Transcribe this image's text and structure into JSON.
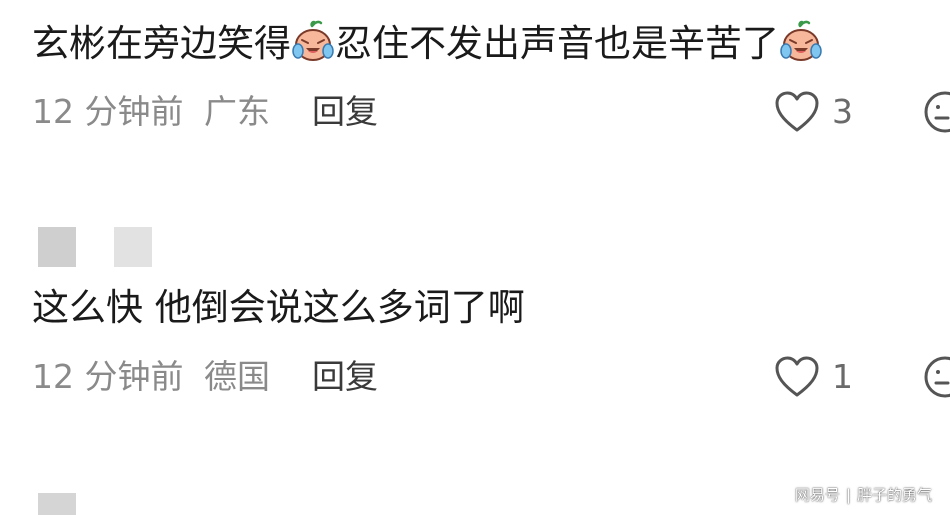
{
  "comments": [
    {
      "text_parts": [
        "玄彬在旁边笑得",
        "忍住不发出声音也是辛苦了",
        ""
      ],
      "emoji": "laugh-cry-icon",
      "time": "12 分钟前",
      "location": "广东",
      "reply_label": "回复",
      "likes": "3"
    },
    {
      "text": "这么快 他倒会说这么多词了啊",
      "time": "12 分钟前",
      "location": "德国",
      "reply_label": "回复",
      "likes": "1"
    }
  ],
  "watermark": {
    "brand": "网易号",
    "separator": "|",
    "author": "胖子的勇气"
  },
  "colors": {
    "text": "#1a1a1a",
    "meta": "#8a8a8a",
    "reply": "#3a3a3a",
    "placeholder": "#cfcfcf"
  }
}
